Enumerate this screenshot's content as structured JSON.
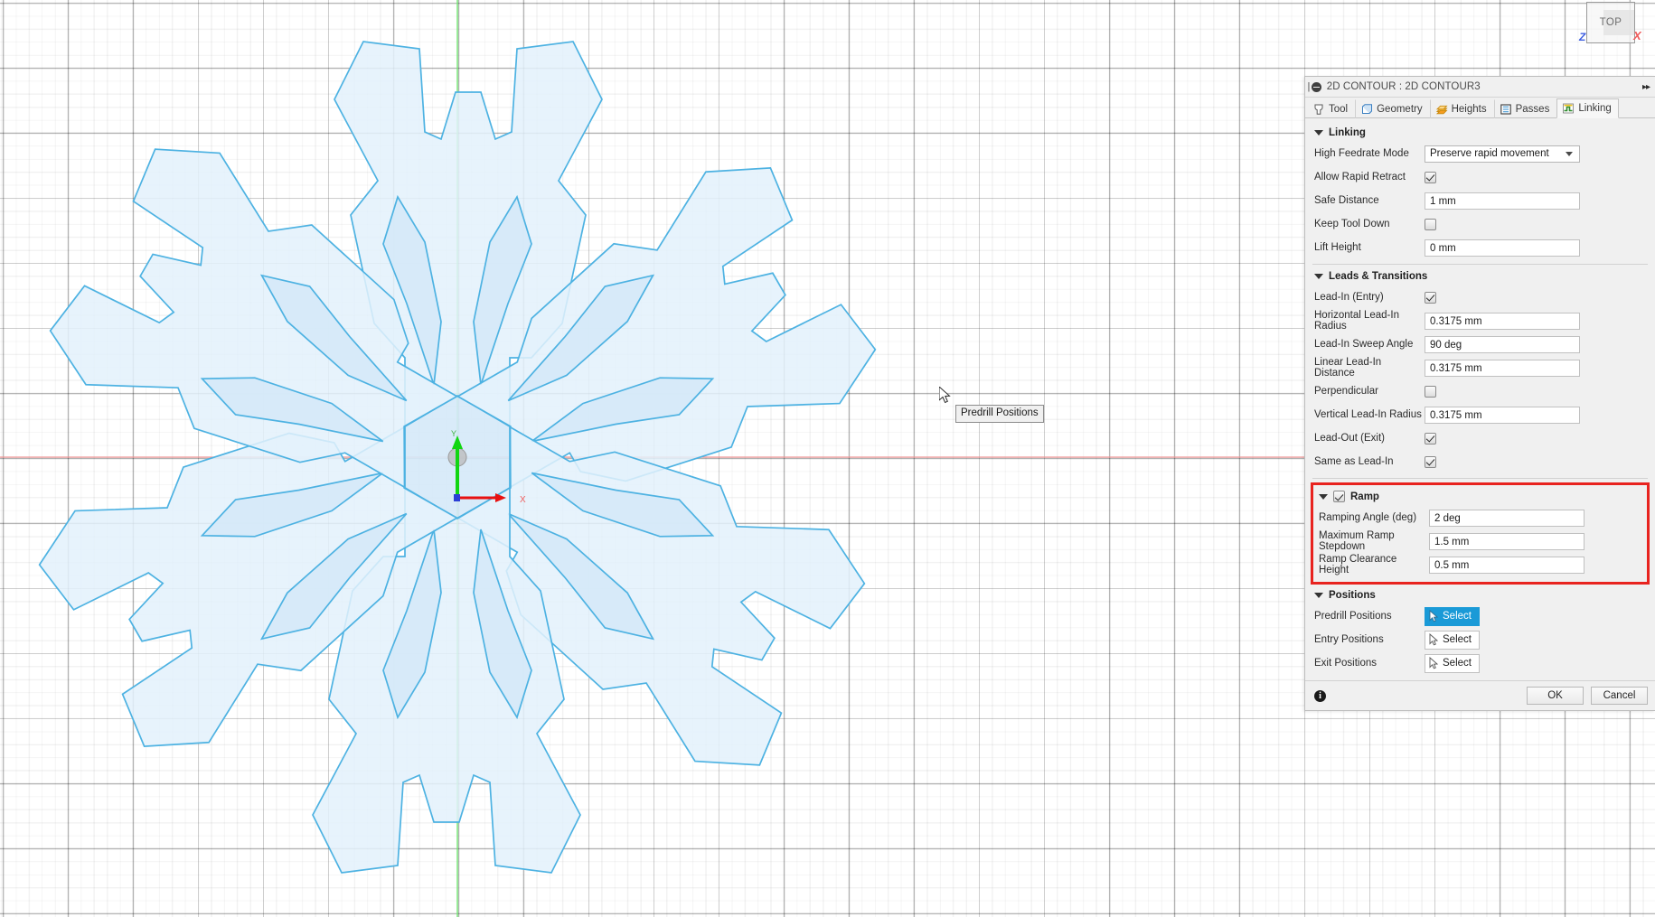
{
  "viewport": {
    "viewcube": {
      "face_label": "TOP",
      "axis_z_label": "Z",
      "axis_x_label": "X"
    },
    "origin_axes": {
      "x_label": "X",
      "y_label": "Y"
    },
    "tooltip": "Predrill Positions",
    "colors": {
      "sketch_stroke": "#4db2e2",
      "sketch_fill": "#e3f1fb",
      "x_axis": "#f04040",
      "y_axis": "#12d612",
      "grid_minor": "#e8e8e8",
      "grid_major": "#bdbdbd"
    }
  },
  "panel": {
    "title": "2D CONTOUR : 2D CONTOUR3",
    "expand_icon": "double-chevron-right",
    "tabs": [
      {
        "label": "Tool",
        "icon": "tool-icon",
        "active": false
      },
      {
        "label": "Geometry",
        "icon": "geometry-icon",
        "active": false
      },
      {
        "label": "Heights",
        "icon": "heights-icon",
        "active": false
      },
      {
        "label": "Passes",
        "icon": "passes-icon",
        "active": false
      },
      {
        "label": "Linking",
        "icon": "linking-icon",
        "active": true
      }
    ],
    "sections": {
      "linking": {
        "title": "Linking",
        "high_feedrate_mode": {
          "label": "High Feedrate Mode",
          "value": "Preserve rapid movement"
        },
        "allow_rapid_retract": {
          "label": "Allow Rapid Retract",
          "checked": true
        },
        "safe_distance": {
          "label": "Safe Distance",
          "value": "1 mm"
        },
        "keep_tool_down": {
          "label": "Keep Tool Down",
          "checked": false
        },
        "lift_height": {
          "label": "Lift Height",
          "value": "0 mm"
        }
      },
      "leads": {
        "title": "Leads & Transitions",
        "lead_in_entry": {
          "label": "Lead-In (Entry)",
          "checked": true
        },
        "horizontal_lead_in_radius": {
          "label": "Horizontal Lead-In Radius",
          "value": "0.3175 mm"
        },
        "lead_in_sweep_angle": {
          "label": "Lead-In Sweep Angle",
          "value": "90 deg"
        },
        "linear_lead_in_distance": {
          "label": "Linear Lead-In Distance",
          "value": "0.3175 mm"
        },
        "perpendicular": {
          "label": "Perpendicular",
          "checked": false
        },
        "vertical_lead_in_radius": {
          "label": "Vertical Lead-In Radius",
          "value": "0.3175 mm"
        },
        "lead_out_exit": {
          "label": "Lead-Out (Exit)",
          "checked": true
        },
        "same_as_lead_in": {
          "label": "Same as Lead-In",
          "checked": true
        }
      },
      "ramp": {
        "title": "Ramp",
        "enabled": true,
        "highlight_color": "#e8231f",
        "ramping_angle": {
          "label": "Ramping Angle (deg)",
          "value": "2 deg"
        },
        "maximum_ramp_stepdown": {
          "label": "Maximum Ramp Stepdown",
          "value": "1.5 mm"
        },
        "ramp_clearance_height": {
          "label": "Ramp Clearance Height",
          "value": "0.5 mm"
        }
      },
      "positions": {
        "title": "Positions",
        "predrill": {
          "label": "Predrill Positions",
          "button": "Select",
          "active": true
        },
        "entry": {
          "label": "Entry Positions",
          "button": "Select",
          "active": false
        },
        "exit": {
          "label": "Exit Positions",
          "button": "Select",
          "active": false
        }
      }
    },
    "footer": {
      "info_label": "i",
      "ok_label": "OK",
      "cancel_label": "Cancel"
    }
  }
}
